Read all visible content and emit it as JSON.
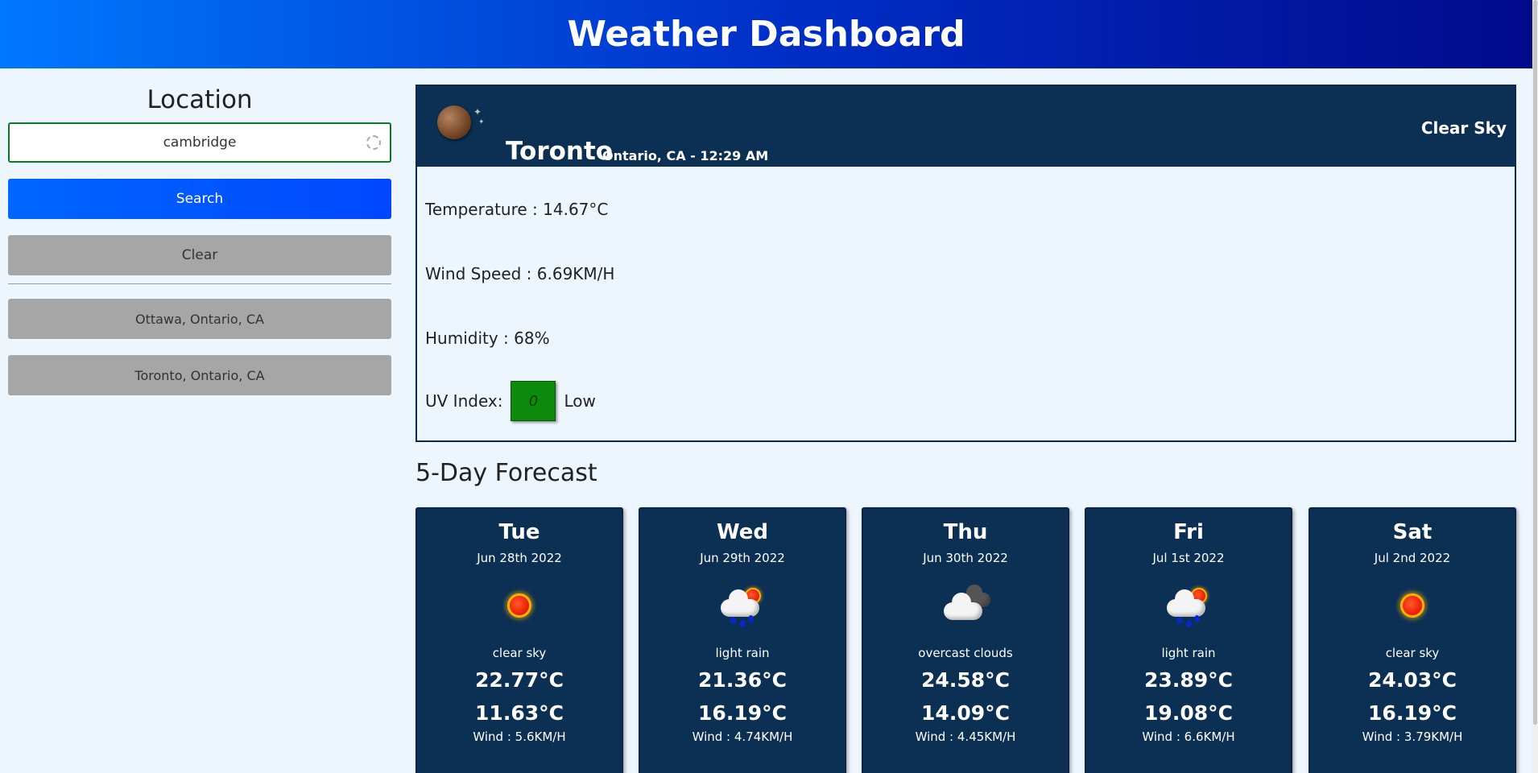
{
  "header": {
    "title": "Weather Dashboard"
  },
  "sidebar": {
    "heading": "Location",
    "search_value": "cambridge",
    "search_button": "Search",
    "clear_button": "Clear",
    "history": [
      "Ottawa, Ontario, CA",
      "Toronto, Ontario, CA"
    ]
  },
  "current": {
    "city": "Toronto",
    "meta": "Ontario, CA - 12:29 AM",
    "condition": "Clear Sky",
    "temperature": "Temperature : 14.67°C",
    "wind": "Wind Speed : 6.69KM/H",
    "humidity": "Humidity : 68%",
    "uv_label": "UV Index:",
    "uv_value": "0",
    "uv_level": "Low",
    "uv_color": "#0b8a0b",
    "icon": "moon-icon"
  },
  "forecast": {
    "title": "5-Day Forecast",
    "days": [
      {
        "day": "Tue",
        "date": "Jun 28th 2022",
        "icon": "sun-icon",
        "desc": "clear sky",
        "high": "22.77°C",
        "low": "11.63°C",
        "wind": "Wind : 5.6KM/H"
      },
      {
        "day": "Wed",
        "date": "Jun 29th 2022",
        "icon": "rain-icon",
        "desc": "light rain",
        "high": "21.36°C",
        "low": "16.19°C",
        "wind": "Wind : 4.74KM/H"
      },
      {
        "day": "Thu",
        "date": "Jun 30th 2022",
        "icon": "cloud-icon",
        "desc": "overcast clouds",
        "high": "24.58°C",
        "low": "14.09°C",
        "wind": "Wind : 4.45KM/H"
      },
      {
        "day": "Fri",
        "date": "Jul 1st 2022",
        "icon": "rain-icon",
        "desc": "light rain",
        "high": "23.89°C",
        "low": "19.08°C",
        "wind": "Wind : 6.6KM/H"
      },
      {
        "day": "Sat",
        "date": "Jul 2nd 2022",
        "icon": "sun-icon",
        "desc": "clear sky",
        "high": "24.03°C",
        "low": "16.19°C",
        "wind": "Wind : 3.79KM/H"
      }
    ]
  }
}
